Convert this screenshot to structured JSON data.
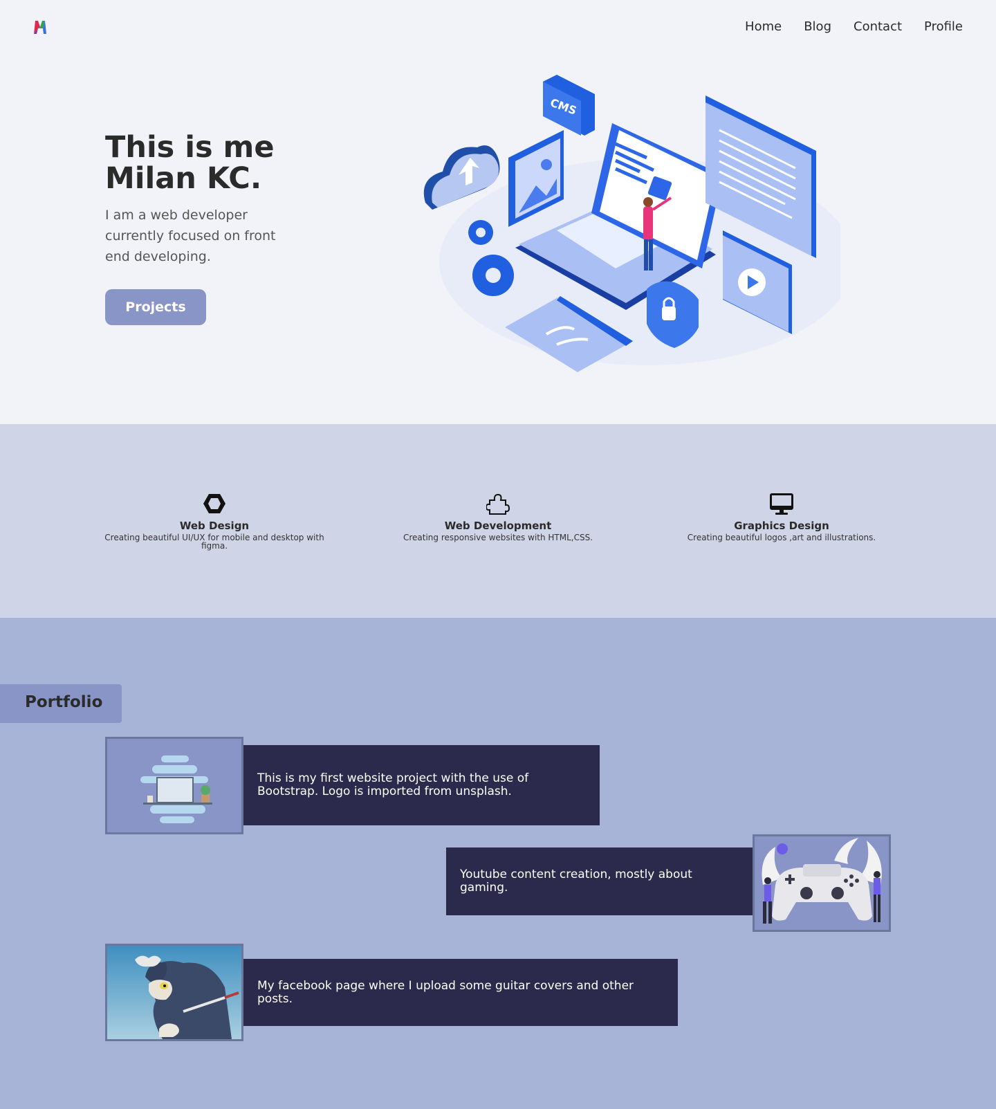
{
  "nav": {
    "items": [
      "Home",
      "Blog",
      "Contact",
      "Profile"
    ]
  },
  "hero": {
    "title_line1": "This is me",
    "title_line2": "Milan KC.",
    "subtitle": "I am a web developer currently focused on front end developing.",
    "button_label": "Projects",
    "illustration_label": "CMS"
  },
  "services": [
    {
      "icon": "hexagon-icon",
      "title": "Web Design",
      "desc": "Creating beautiful UI/UX for mobile and desktop with figma."
    },
    {
      "icon": "puzzle-icon",
      "title": "Web Development",
      "desc": "Creating responsive websites with HTML,CSS."
    },
    {
      "icon": "desktop-icon",
      "title": "Graphics Design",
      "desc": "Creating beautiful logos ,art and illustrations."
    }
  ],
  "portfolio": {
    "heading": "Portfolio",
    "items": [
      {
        "text": "This is my first website project with the use of Bootstrap. Logo is imported from unsplash.",
        "image": "desk-computer-illustration"
      },
      {
        "text": "Youtube content creation, mostly about gaming.",
        "image": "game-controller-illustration"
      },
      {
        "text": "My facebook page where I upload some guitar covers and other posts.",
        "image": "cartoon-cat-image"
      }
    ]
  },
  "colors": {
    "hero_bg": "#f2f3f8",
    "services_bg": "#cfd4e7",
    "portfolio_bg": "#a8b4d7",
    "accent": "#8895c6",
    "card_bg": "#2b2a4c"
  }
}
